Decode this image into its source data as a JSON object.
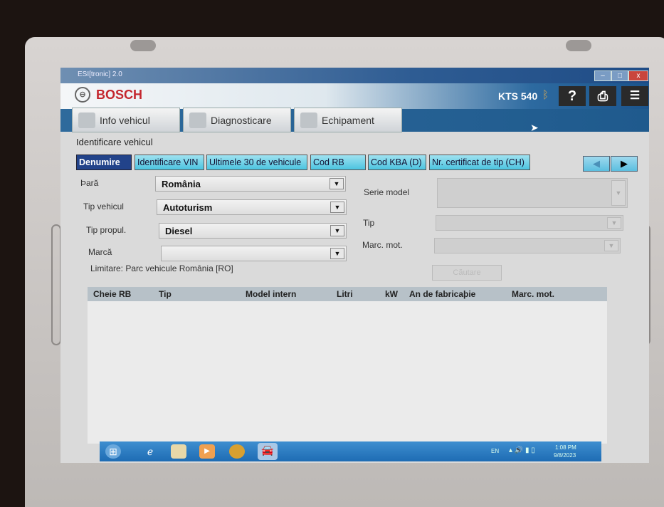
{
  "window": {
    "title": "ESI[tronic] 2.0",
    "minimize": "–",
    "maximize": "□",
    "close": "x"
  },
  "header": {
    "brand": "BOSCH",
    "device": "KTS 540",
    "help": "?",
    "print": "⎙",
    "menu": "☰"
  },
  "main_tabs": [
    {
      "label": "Info vehicul"
    },
    {
      "label": "Diagnosticare"
    },
    {
      "label": "Echipament"
    }
  ],
  "section_title": "Identificare vehicul",
  "sub_tabs": [
    {
      "label": "Denumire",
      "active": true
    },
    {
      "label": "Identificare VIN"
    },
    {
      "label": "Ultimele 30 de vehicule"
    },
    {
      "label": "Cod RB"
    },
    {
      "label": "Cod KBA (D)"
    },
    {
      "label": "Nr. certificat de tip (CH)"
    }
  ],
  "nav": {
    "prev": "◀",
    "next": "▶"
  },
  "form": {
    "country": {
      "label": "Þară",
      "value": "România"
    },
    "vehicle_type": {
      "label": "Tip vehicul",
      "value": "Autoturism"
    },
    "propulsion": {
      "label": "Tip propul.",
      "value": "Diesel"
    },
    "make": {
      "label": "Marcă",
      "value": ""
    },
    "limitation": "Limitare: Parc vehicule România [RO]",
    "model_series": {
      "label": "Serie model"
    },
    "type": {
      "label": "Tip"
    },
    "engine_code": {
      "label": "Marc. mot."
    },
    "search_button": "Căutare"
  },
  "table": {
    "columns": [
      "Cheie RB",
      "Tip",
      "Model intern",
      "Litri",
      "kW",
      "An de fabricaþie",
      "Marc. mot."
    ],
    "rows": []
  },
  "taskbar": {
    "lang": "EN",
    "time": "1:08 PM",
    "date": "9/8/2023"
  }
}
